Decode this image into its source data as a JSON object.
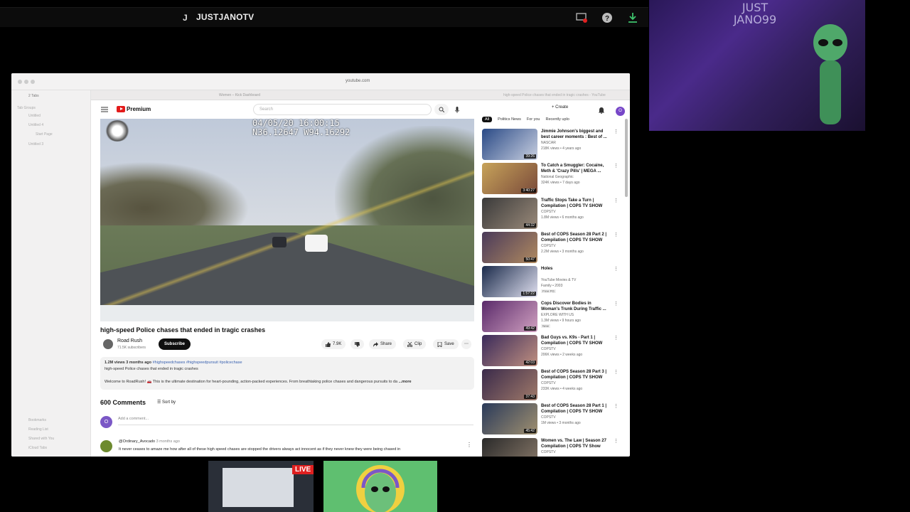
{
  "stream": {
    "initial": "J",
    "channel": "JUSTJANOTV",
    "live_label": "LIVE",
    "webcam_sign": "JUST JANO99"
  },
  "safari": {
    "url": "youtube.com",
    "tab_left": "Women – Kick Dashboard",
    "tab_right": "high-speed Police chases that ended in tragic crashes - YouTube",
    "sidebar": [
      "2 Tabs",
      "Tab Groups",
      "Untitled",
      "Untitled 4",
      "Start Page",
      "Untitled 3",
      "Bookmarks",
      "Reading List",
      "Shared with You",
      "iCloud Tabs"
    ]
  },
  "youtube": {
    "brand": "Premium",
    "search_placeholder": "Search",
    "create_label": "Create",
    "avatar_letter": "O"
  },
  "video": {
    "timestamp": "04/05/20 16:00:15",
    "coords": "N36.12647 W94.16292",
    "title": "high-speed Police chases that ended in tragic crashes",
    "channel": "Road Rush",
    "subscribers": "71.5K subscribers",
    "subscribe": "Subscribe",
    "likes": "7.9K",
    "share": "Share",
    "clip": "Clip",
    "save": "Save",
    "views": "1.2M views  3 months ago",
    "hashtags": "#highspeedchases #highspeedpursuit #policechase",
    "desc_line1": "high-speed Police chases that ended in tragic crashes",
    "desc_line2": "Welcome to RoadRush! 🚗 This is the ultimate destination for heart-pounding, action-packed experiences. From breathtaking police chases and dangerous pursuits to da",
    "more": "...more"
  },
  "comments": {
    "count": "600 Comments",
    "sort": "Sort by",
    "add": "Add a comment...",
    "user": "@Ordinary_Avocado",
    "time": "3 months ago",
    "text": "It never ceases to amaze me how after all of these high speed chases are stopped the drivers always act innocent as if they never knew they were being chased in"
  },
  "chips": [
    "All",
    "Politics News",
    "For you",
    "Recently uplo"
  ],
  "recs": [
    {
      "title": "Jimmie Johnson's biggest and best career moments : Best of ...",
      "channel": "NASCAR",
      "meta": "218K views • 4 years ago",
      "dur": "39:26",
      "c1": "#2a4a86",
      "c2": "#c8cfe0"
    },
    {
      "title": "To Catch a Smuggler: Cocaine, Meth & 'Crazy Pills' | MEGA ...",
      "channel": "National Geographic",
      "meta": "324K views • 7 days ago",
      "dur": "3:40:27",
      "c1": "#c7a35a",
      "c2": "#7a4a3a"
    },
    {
      "title": "Traffic Stops Take a Turn | Compilation | COPS TV SHOW",
      "channel": "COPSTV",
      "meta": "1.8M views • 6 months ago",
      "dur": "44:32",
      "c1": "#3a3a3a",
      "c2": "#9a8a7a"
    },
    {
      "title": "Best of COPS Season 28 Part 2 | Compilation | COPS TV SHOW",
      "channel": "COPSTV",
      "meta": "2.2M views • 3 months ago",
      "dur": "50:47",
      "c1": "#4a3a5a",
      "c2": "#b08a60"
    },
    {
      "title": "Holes",
      "channel": "YouTube Movies & TV",
      "meta": "Family • 2003",
      "dur": "1:57:22",
      "badge": "Free  PG",
      "c1": "#1a2a4a",
      "c2": "#e0e0f0"
    },
    {
      "title": "Cops Discover Bodies in Woman's Trunk During Traffic ...",
      "channel": "EXPLORE WITH US",
      "meta": "1.3M views • 9 hours ago",
      "dur": "49:42",
      "badge": "New",
      "c1": "#5a2a6a",
      "c2": "#d0a0c0"
    },
    {
      "title": "Bad Guys vs. K9s - Part 1 | Compilation | COPS TV SHOW",
      "channel": "COPSTV",
      "meta": "206K views • 2 weeks ago",
      "dur": "42:03",
      "c1": "#3a2a5a",
      "c2": "#c09080"
    },
    {
      "title": "Best of COPS Season 28 Part 3 | Compilation | COPS TV SHOW",
      "channel": "COPSTV",
      "meta": "233K views • 4 weeks ago",
      "dur": "37:43",
      "c1": "#3a2a4a",
      "c2": "#a07a6a"
    },
    {
      "title": "Best of COPS Season 28 Part 1 | Compilation | COPS TV SHOW",
      "channel": "COPSTV",
      "meta": "1M views • 3 months ago",
      "dur": "45:42",
      "c1": "#2a3a5a",
      "c2": "#a09070"
    },
    {
      "title": "Women vs. The Law | Season 27 Compilation | COPS TV Show",
      "channel": "COPSTV",
      "meta": "",
      "dur": "",
      "c1": "#2a2a2a",
      "c2": "#8a7a6a"
    }
  ]
}
